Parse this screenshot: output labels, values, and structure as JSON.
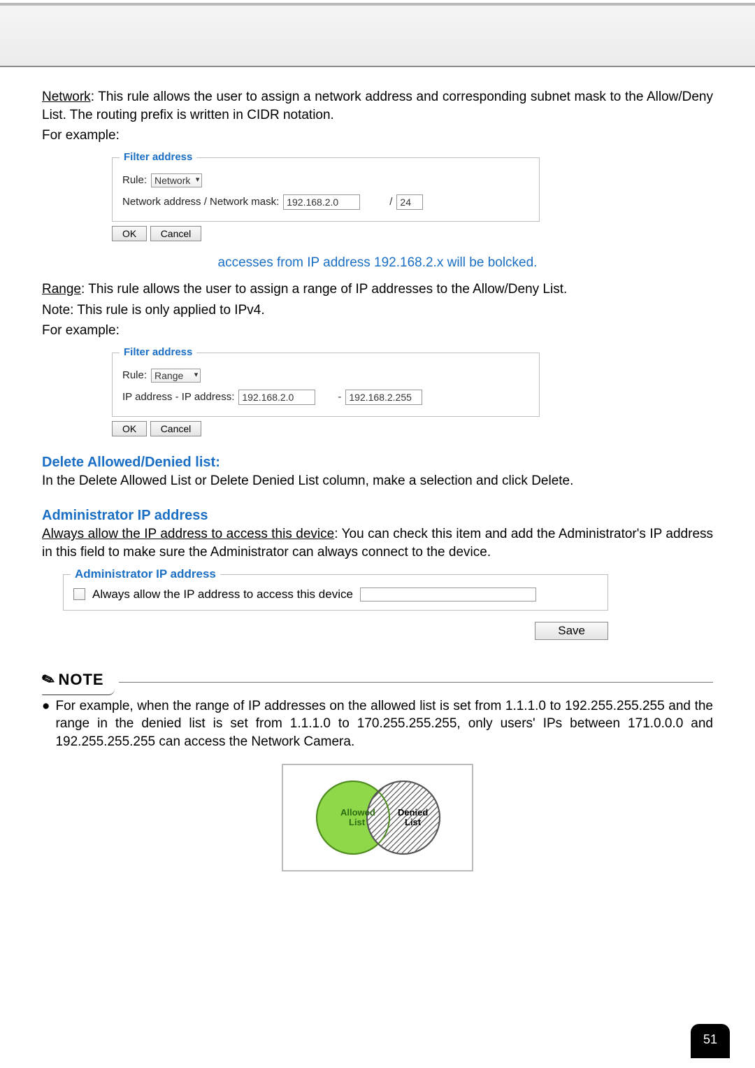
{
  "para1": {
    "network_label": "Network",
    "text_after": ": This rule allows the user to assign a network address and corresponding subnet mask to the Allow/Deny List. The routing prefix is written in CIDR notation.",
    "for_example": "For example:"
  },
  "fbox1": {
    "title": "Filter address",
    "rule_label": "Rule:",
    "rule_value": "Network",
    "addr_label": "Network address / Network mask:",
    "addr_value": "192.168.2.0",
    "slash": "/",
    "mask_value": "24",
    "ok": "OK",
    "cancel": "Cancel"
  },
  "caption1": "accesses from IP address 192.168.2.x will be bolcked.",
  "para2": {
    "range_label": "Range",
    "text_after": ": This rule allows the user to assign a range of IP addresses to the Allow/Deny List.",
    "note": "Note: This rule is only applied to IPv4.",
    "for_example": "For example:"
  },
  "fbox2": {
    "title": "Filter address",
    "rule_label": "Rule:",
    "rule_value": "Range",
    "addr_label": "IP address - IP address:",
    "ip_from": "192.168.2.0",
    "dash": "-",
    "ip_to": "192.168.2.255",
    "ok": "OK",
    "cancel": "Cancel"
  },
  "delete_section": {
    "heading": "Delete Allowed/Denied list:",
    "text": "In the Delete Allowed List or Delete Denied List column, make a selection and click Delete."
  },
  "admin_section": {
    "heading": "Administrator IP address",
    "always_label": "Always allow the IP address to access this device",
    "text_after": ": You can check this item and add the Administrator's IP address in this field to make sure the Administrator can always connect to the device."
  },
  "admin_box": {
    "title": "Administrator IP address",
    "checkbox_label": "Always allow the IP address to access this device",
    "save": "Save"
  },
  "note": {
    "label": "NOTE",
    "bullet": "For example, when the range of IP addresses on the allowed list is set from 1.1.1.0 to 192.255.255.255 and the range in the denied list is set from 1.1.1.0 to 170.255.255.255, only users' IPs between 171.0.0.0 and 192.255.255.255 can access the Network Camera."
  },
  "venn": {
    "allowed": "Allowed",
    "allowed2": "List",
    "denied": "Denied",
    "denied2": "List"
  },
  "page_number": "51"
}
